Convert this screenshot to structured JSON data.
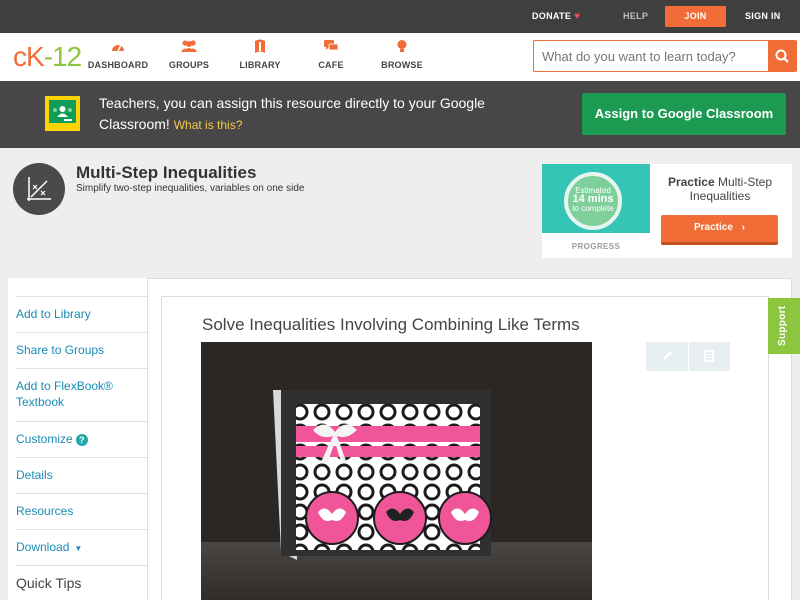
{
  "topbar": {
    "donate": "DONATE",
    "help": "HELP",
    "join": "JOIN",
    "signin": "SIGN IN"
  },
  "logo": {
    "c": "c",
    "k": "K",
    "n": "-12"
  },
  "nav": {
    "items": [
      {
        "label": "DASHBOARD",
        "icon": "dashboard-icon"
      },
      {
        "label": "GROUPS",
        "icon": "groups-icon"
      },
      {
        "label": "LIBRARY",
        "icon": "library-icon"
      },
      {
        "label": "CAFE",
        "icon": "cafe-icon"
      },
      {
        "label": "BROWSE",
        "icon": "browse-icon"
      }
    ],
    "search_placeholder": "What do you want to learn today?"
  },
  "classroom": {
    "message": "Teachers, you can assign this resource directly to your Google Classroom!",
    "what_link": "What is this?",
    "button": "Assign to Google Classroom"
  },
  "concept": {
    "title": "Multi-Step Inequalities",
    "subtitle": "Simplify two-step inequalities, variables on one side"
  },
  "practice": {
    "estimated": "Estimated",
    "minutes": "14 mins",
    "to_complete": "to complete",
    "progress_label": "PROGRESS",
    "title_bold": "Practice",
    "title_rest": "Multi-Step Inequalities",
    "button": "Practice"
  },
  "sidebar": {
    "items": [
      {
        "label": "Add to Library"
      },
      {
        "label": "Share to Groups"
      },
      {
        "label": "Add to FlexBook® Textbook"
      },
      {
        "label": "Customize"
      },
      {
        "label": "Details"
      },
      {
        "label": "Resources"
      },
      {
        "label": "Download"
      }
    ],
    "quick_tips": "Quick Tips"
  },
  "article": {
    "title": "Solve Inequalities Involving Combining Like Terms"
  },
  "support": {
    "label": "Support"
  },
  "colors": {
    "accent": "#f16c36",
    "brand_green": "#8cc63f",
    "classroom_green": "#1d9a52",
    "link": "#1a8bb5"
  }
}
